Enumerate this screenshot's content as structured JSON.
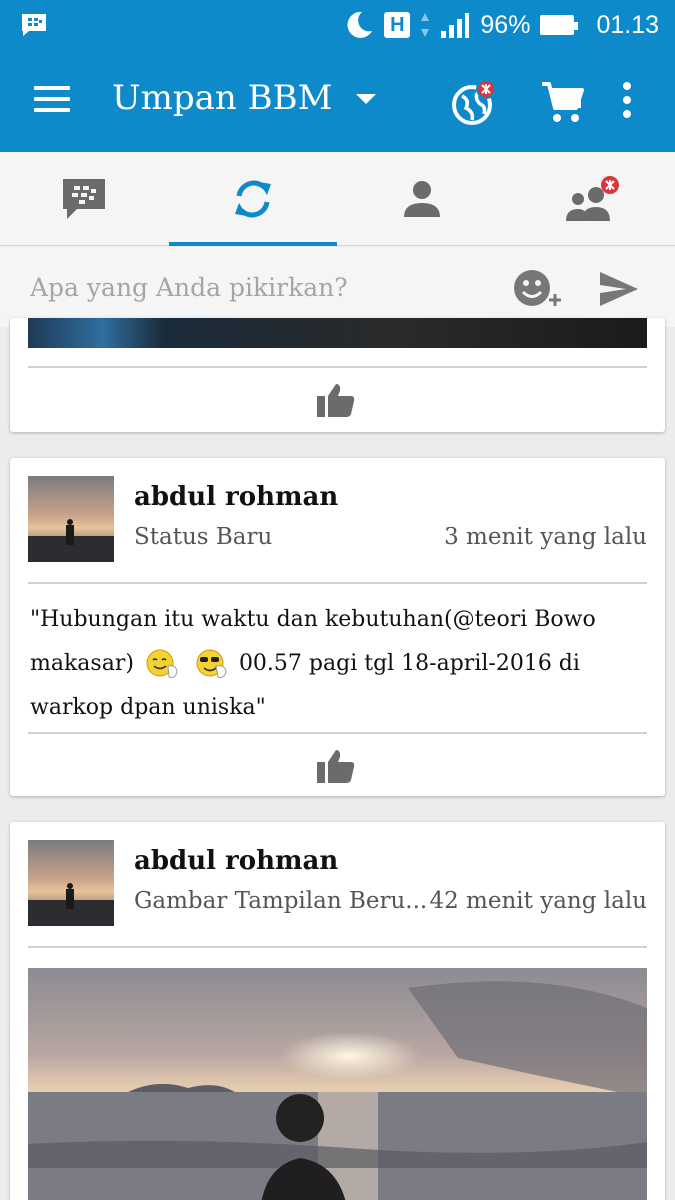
{
  "status_bar": {
    "network_type": "H",
    "battery": "96%",
    "time": "01.13",
    "icons": [
      "bbm-notification-icon",
      "moon-icon",
      "signal-icon",
      "battery-icon"
    ]
  },
  "app_bar": {
    "title": "Umpan BBM",
    "icons": [
      "menu-icon",
      "globe-icon",
      "cart-icon",
      "more-vertical-icon"
    ]
  },
  "tabs": [
    {
      "icon": "chat-icon",
      "active": false
    },
    {
      "icon": "updates-icon",
      "active": true
    },
    {
      "icon": "contact-icon",
      "active": false
    },
    {
      "icon": "groups-icon",
      "active": false
    }
  ],
  "compose": {
    "placeholder": "Apa yang Anda pikirkan?"
  },
  "posts": [
    {
      "author": "abdul rohman",
      "type": "Status Baru",
      "time": "3 menit yang lalu",
      "text_line1": "\"Hubungan itu waktu dan kebutuhan(@teori Bowo",
      "text_line2_a": "makasar)",
      "text_line2_b": "00.57 pagi tgl 18-april-2016 di",
      "text_line3": "warkop dpan uniska\""
    },
    {
      "author": "abdul rohman",
      "type": "Gambar Tampilan Beru...",
      "time": "42 menit yang lalu"
    }
  ],
  "colors": {
    "accent": "#0e8acb",
    "icon_gray": "#6b6b6b",
    "badge_red": "#d9363e"
  }
}
